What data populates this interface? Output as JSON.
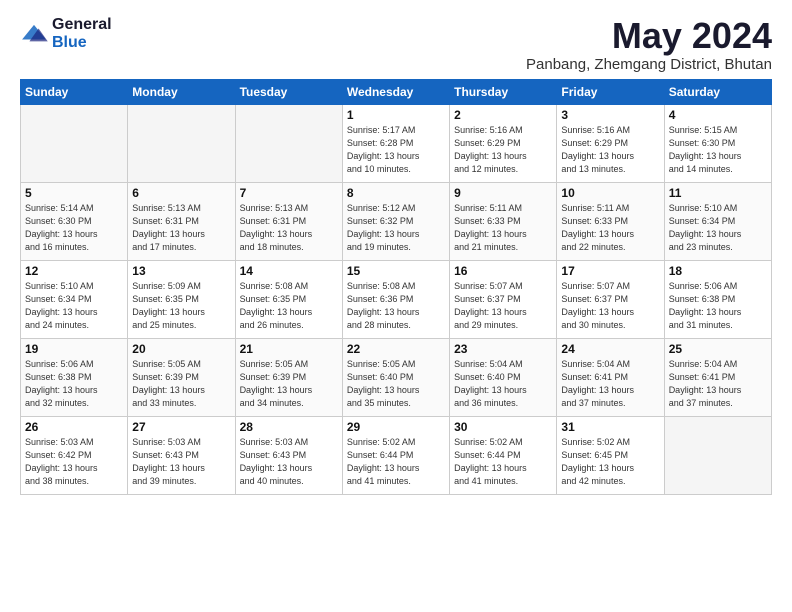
{
  "header": {
    "logo_general": "General",
    "logo_blue": "Blue",
    "title": "May 2024",
    "subtitle": "Panbang, Zhemgang District, Bhutan"
  },
  "weekdays": [
    "Sunday",
    "Monday",
    "Tuesday",
    "Wednesday",
    "Thursday",
    "Friday",
    "Saturday"
  ],
  "weeks": [
    [
      {
        "day": "",
        "detail": ""
      },
      {
        "day": "",
        "detail": ""
      },
      {
        "day": "",
        "detail": ""
      },
      {
        "day": "1",
        "detail": "Sunrise: 5:17 AM\nSunset: 6:28 PM\nDaylight: 13 hours\nand 10 minutes."
      },
      {
        "day": "2",
        "detail": "Sunrise: 5:16 AM\nSunset: 6:29 PM\nDaylight: 13 hours\nand 12 minutes."
      },
      {
        "day": "3",
        "detail": "Sunrise: 5:16 AM\nSunset: 6:29 PM\nDaylight: 13 hours\nand 13 minutes."
      },
      {
        "day": "4",
        "detail": "Sunrise: 5:15 AM\nSunset: 6:30 PM\nDaylight: 13 hours\nand 14 minutes."
      }
    ],
    [
      {
        "day": "5",
        "detail": "Sunrise: 5:14 AM\nSunset: 6:30 PM\nDaylight: 13 hours\nand 16 minutes."
      },
      {
        "day": "6",
        "detail": "Sunrise: 5:13 AM\nSunset: 6:31 PM\nDaylight: 13 hours\nand 17 minutes."
      },
      {
        "day": "7",
        "detail": "Sunrise: 5:13 AM\nSunset: 6:31 PM\nDaylight: 13 hours\nand 18 minutes."
      },
      {
        "day": "8",
        "detail": "Sunrise: 5:12 AM\nSunset: 6:32 PM\nDaylight: 13 hours\nand 19 minutes."
      },
      {
        "day": "9",
        "detail": "Sunrise: 5:11 AM\nSunset: 6:33 PM\nDaylight: 13 hours\nand 21 minutes."
      },
      {
        "day": "10",
        "detail": "Sunrise: 5:11 AM\nSunset: 6:33 PM\nDaylight: 13 hours\nand 22 minutes."
      },
      {
        "day": "11",
        "detail": "Sunrise: 5:10 AM\nSunset: 6:34 PM\nDaylight: 13 hours\nand 23 minutes."
      }
    ],
    [
      {
        "day": "12",
        "detail": "Sunrise: 5:10 AM\nSunset: 6:34 PM\nDaylight: 13 hours\nand 24 minutes."
      },
      {
        "day": "13",
        "detail": "Sunrise: 5:09 AM\nSunset: 6:35 PM\nDaylight: 13 hours\nand 25 minutes."
      },
      {
        "day": "14",
        "detail": "Sunrise: 5:08 AM\nSunset: 6:35 PM\nDaylight: 13 hours\nand 26 minutes."
      },
      {
        "day": "15",
        "detail": "Sunrise: 5:08 AM\nSunset: 6:36 PM\nDaylight: 13 hours\nand 28 minutes."
      },
      {
        "day": "16",
        "detail": "Sunrise: 5:07 AM\nSunset: 6:37 PM\nDaylight: 13 hours\nand 29 minutes."
      },
      {
        "day": "17",
        "detail": "Sunrise: 5:07 AM\nSunset: 6:37 PM\nDaylight: 13 hours\nand 30 minutes."
      },
      {
        "day": "18",
        "detail": "Sunrise: 5:06 AM\nSunset: 6:38 PM\nDaylight: 13 hours\nand 31 minutes."
      }
    ],
    [
      {
        "day": "19",
        "detail": "Sunrise: 5:06 AM\nSunset: 6:38 PM\nDaylight: 13 hours\nand 32 minutes."
      },
      {
        "day": "20",
        "detail": "Sunrise: 5:05 AM\nSunset: 6:39 PM\nDaylight: 13 hours\nand 33 minutes."
      },
      {
        "day": "21",
        "detail": "Sunrise: 5:05 AM\nSunset: 6:39 PM\nDaylight: 13 hours\nand 34 minutes."
      },
      {
        "day": "22",
        "detail": "Sunrise: 5:05 AM\nSunset: 6:40 PM\nDaylight: 13 hours\nand 35 minutes."
      },
      {
        "day": "23",
        "detail": "Sunrise: 5:04 AM\nSunset: 6:40 PM\nDaylight: 13 hours\nand 36 minutes."
      },
      {
        "day": "24",
        "detail": "Sunrise: 5:04 AM\nSunset: 6:41 PM\nDaylight: 13 hours\nand 37 minutes."
      },
      {
        "day": "25",
        "detail": "Sunrise: 5:04 AM\nSunset: 6:41 PM\nDaylight: 13 hours\nand 37 minutes."
      }
    ],
    [
      {
        "day": "26",
        "detail": "Sunrise: 5:03 AM\nSunset: 6:42 PM\nDaylight: 13 hours\nand 38 minutes."
      },
      {
        "day": "27",
        "detail": "Sunrise: 5:03 AM\nSunset: 6:43 PM\nDaylight: 13 hours\nand 39 minutes."
      },
      {
        "day": "28",
        "detail": "Sunrise: 5:03 AM\nSunset: 6:43 PM\nDaylight: 13 hours\nand 40 minutes."
      },
      {
        "day": "29",
        "detail": "Sunrise: 5:02 AM\nSunset: 6:44 PM\nDaylight: 13 hours\nand 41 minutes."
      },
      {
        "day": "30",
        "detail": "Sunrise: 5:02 AM\nSunset: 6:44 PM\nDaylight: 13 hours\nand 41 minutes."
      },
      {
        "day": "31",
        "detail": "Sunrise: 5:02 AM\nSunset: 6:45 PM\nDaylight: 13 hours\nand 42 minutes."
      },
      {
        "day": "",
        "detail": ""
      }
    ]
  ]
}
